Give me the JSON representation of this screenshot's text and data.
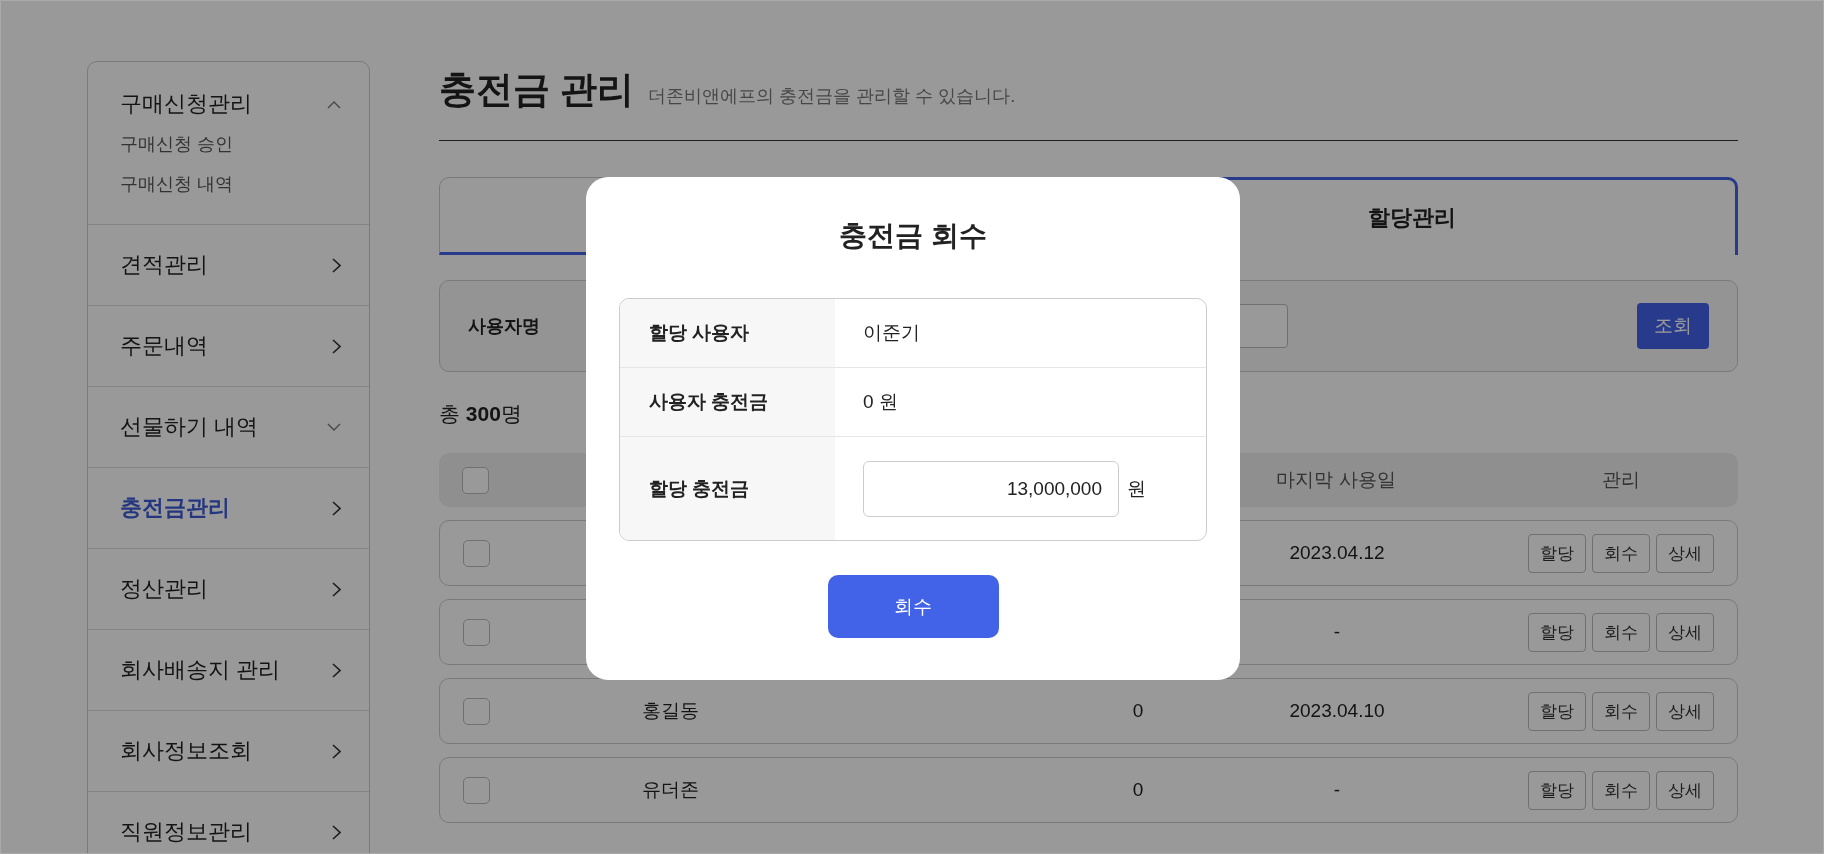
{
  "sidebar": {
    "items": [
      {
        "kind": "group",
        "label": "구매신청관리",
        "expanded": true,
        "selected": false,
        "children": [
          {
            "label": "구매신청 승인"
          },
          {
            "label": "구매신청 내역"
          }
        ]
      },
      {
        "kind": "link",
        "label": "견적관리",
        "selected": false
      },
      {
        "kind": "link",
        "label": "주문내역",
        "selected": false
      },
      {
        "kind": "group",
        "label": "선물하기 내역",
        "expanded": false,
        "selected": false
      },
      {
        "kind": "link",
        "label": "충전금관리",
        "selected": true
      },
      {
        "kind": "link",
        "label": "정산관리",
        "selected": false
      },
      {
        "kind": "link",
        "label": "회사배송지 관리",
        "selected": false
      },
      {
        "kind": "link",
        "label": "회사정보조회",
        "selected": false
      },
      {
        "kind": "link",
        "label": "직원정보관리",
        "selected": false
      }
    ]
  },
  "page": {
    "title": "충전금 관리",
    "subtitle": "더존비앤에프의 충전금을 관리할 수 있습니다."
  },
  "tabs": [
    {
      "selected": false
    },
    {
      "label": "할당관리",
      "selected": true
    }
  ],
  "search": {
    "label": "사용자명",
    "button": "조회"
  },
  "total": "총 **300**명",
  "table": {
    "header": {
      "checked": false,
      "column_4": "마지막 사용일",
      "column_5": "관리"
    },
    "rows": [
      {
        "checked": false,
        "last_used": "2023.04.12",
        "actions": [
          "할당",
          "회수",
          "상세"
        ]
      },
      {
        "checked": false,
        "last_used": "-",
        "actions": [
          "할당",
          "회수",
          "상세"
        ]
      },
      {
        "checked": false,
        "name": "홍길동",
        "amount": "0",
        "last_used": "2023.04.10",
        "actions": [
          "할당",
          "회수",
          "상세"
        ]
      },
      {
        "checked": false,
        "name": "유더존",
        "amount": "0",
        "last_used": "-",
        "actions": [
          "할당",
          "회수",
          "상세"
        ]
      }
    ]
  },
  "modal": {
    "title": "충전금 회수",
    "fields": [
      {
        "kind": "text",
        "label": "할당 사용자",
        "value": "이준기"
      },
      {
        "kind": "text",
        "label": "사용자 충전금",
        "value": "0 원"
      },
      {
        "kind": "input",
        "label": "할당 충전금",
        "value": "13,000,000",
        "unit": "원"
      }
    ],
    "button": "회수"
  }
}
